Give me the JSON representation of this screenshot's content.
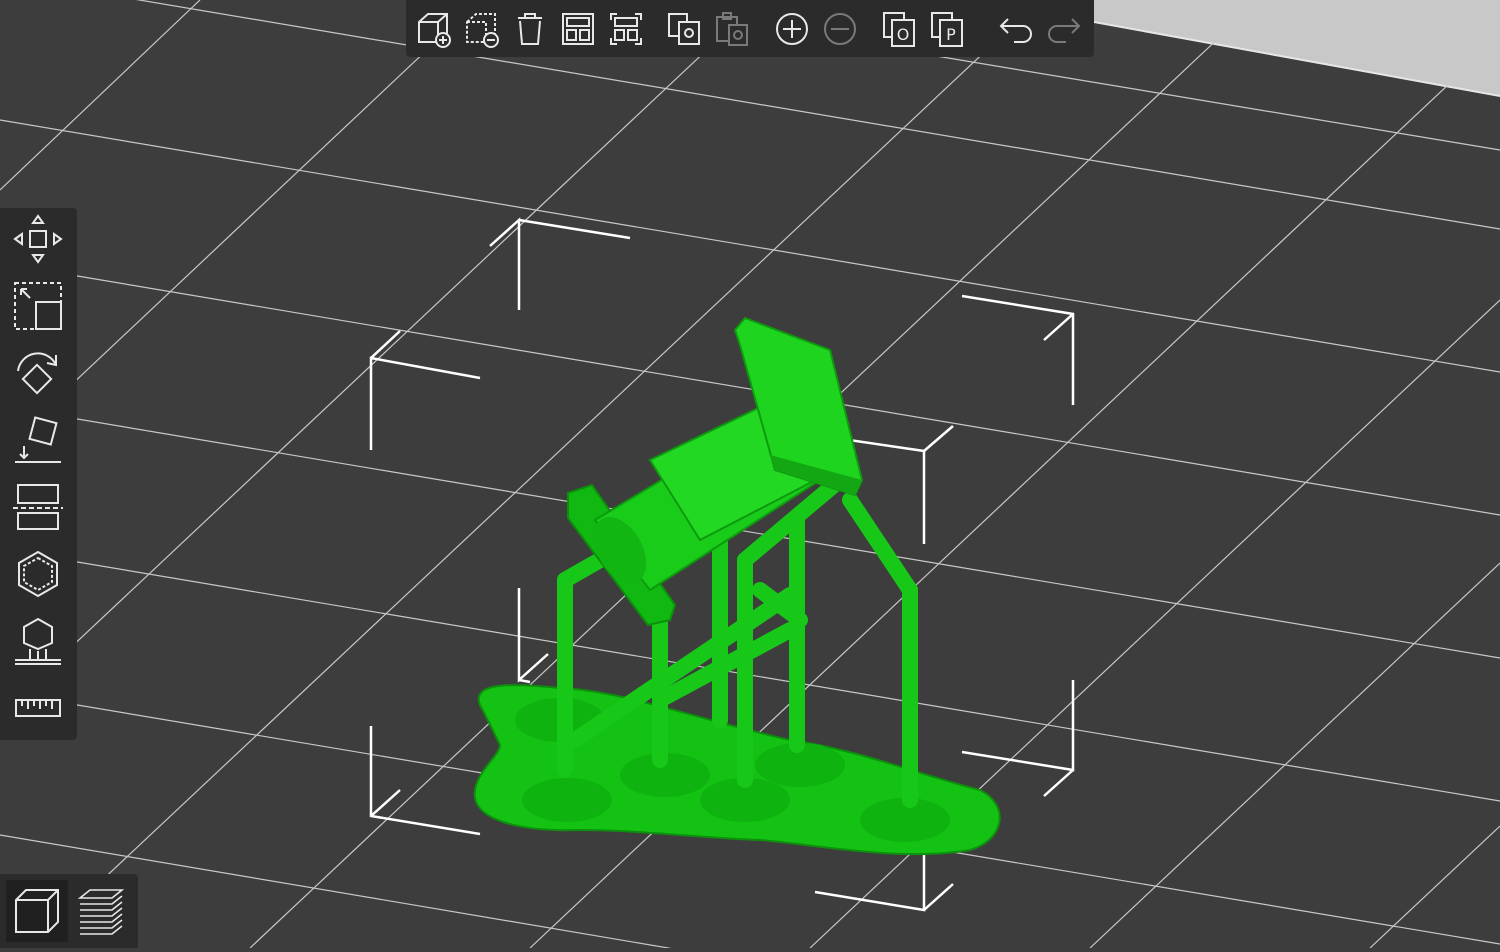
{
  "colors": {
    "plate": "#3d3d3d",
    "grid": "#cfcfcf",
    "toolbar_bg": "#2b2b2b",
    "icon": "#e8e8e8",
    "icon_disabled": "#7a7a7a",
    "model_green": "#1fd41f",
    "model_green_dark": "#11a511",
    "bbox": "#ffffff"
  },
  "top_toolbar": [
    {
      "icon": "add-object-icon",
      "enabled": true
    },
    {
      "icon": "delete-object-icon",
      "enabled": true
    },
    {
      "icon": "delete-all-icon",
      "enabled": true
    },
    {
      "icon": "arrange-icon",
      "enabled": true
    },
    {
      "icon": "arrange-selection-icon",
      "enabled": true
    },
    {
      "icon": "copy-icon",
      "enabled": true
    },
    {
      "icon": "paste-icon",
      "enabled": false
    },
    {
      "icon": "add-instance-icon",
      "enabled": true
    },
    {
      "icon": "remove-instance-icon",
      "enabled": false
    },
    {
      "icon": "split-to-objects-icon",
      "enabled": true,
      "glyph": "O"
    },
    {
      "icon": "split-to-parts-icon",
      "enabled": true,
      "glyph": "P"
    },
    {
      "icon": "undo-icon",
      "enabled": true
    },
    {
      "icon": "redo-icon",
      "enabled": false
    }
  ],
  "left_toolbar": [
    {
      "icon": "move-icon"
    },
    {
      "icon": "scale-icon"
    },
    {
      "icon": "rotate-icon"
    },
    {
      "icon": "place-on-face-icon"
    },
    {
      "icon": "cut-icon"
    },
    {
      "icon": "hollow-icon"
    },
    {
      "icon": "support-points-icon"
    },
    {
      "icon": "measure-icon"
    }
  ],
  "view_switch": [
    {
      "icon": "3d-view-icon",
      "active": true
    },
    {
      "icon": "preview-layers-icon",
      "active": false
    }
  ]
}
